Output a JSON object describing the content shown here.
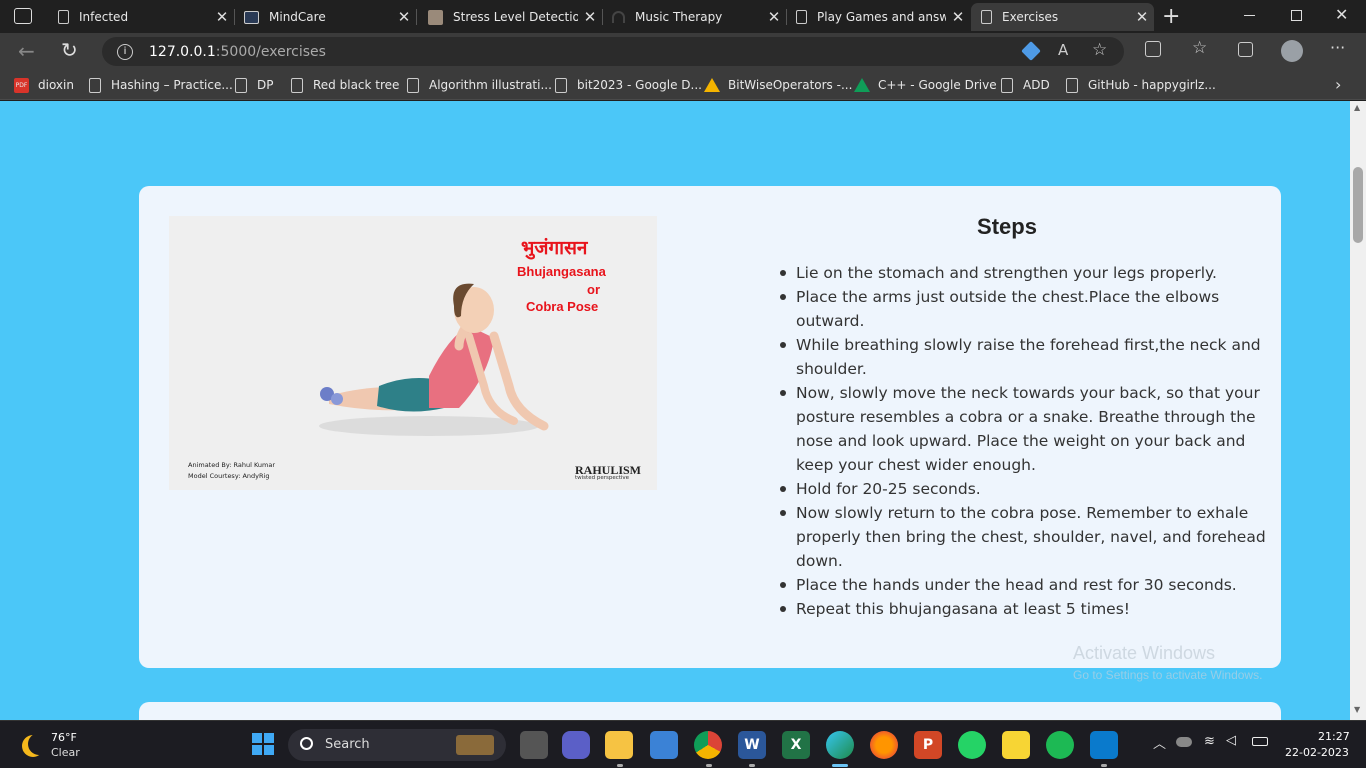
{
  "tabs": [
    {
      "label": "Infected",
      "active": false
    },
    {
      "label": "MindCare",
      "active": false
    },
    {
      "label": "Stress Level Detection",
      "active": false
    },
    {
      "label": "Music Therapy",
      "active": false
    },
    {
      "label": "Play Games and answe",
      "active": false
    },
    {
      "label": "Exercises",
      "active": true
    }
  ],
  "address": {
    "host": "127.0.0.1",
    "path": ":5000/exercises"
  },
  "bookmarks": [
    {
      "label": "dioxin",
      "icon": "pdf-icon"
    },
    {
      "label": "Hashing – Practice...",
      "icon": "page-icon"
    },
    {
      "label": "DP",
      "icon": "page-icon"
    },
    {
      "label": "Red black tree",
      "icon": "page-icon"
    },
    {
      "label": "Algorithm illustrati...",
      "icon": "page-icon"
    },
    {
      "label": "bit2023 - Google D...",
      "icon": "page-icon"
    },
    {
      "label": "BitWiseOperators -...",
      "icon": "drive-icon"
    },
    {
      "label": "C++ - Google Drive",
      "icon": "drive-icon"
    },
    {
      "label": "ADD",
      "icon": "page-icon"
    },
    {
      "label": "GitHub - happygirlz...",
      "icon": "page-icon"
    }
  ],
  "exercise": {
    "image_title_hindi": "भुजंगासन",
    "image_title_line1": "Bhujangasana",
    "image_title_line2": "or",
    "image_title_line3": "Cobra Pose",
    "credit_line1": "Animated By: Rahul Kumar",
    "credit_line2": "Model Courtesy: AndyRig",
    "logo_text": "RAHULISM",
    "logo_sub": "twisted perspective",
    "steps_title": "Steps",
    "steps": [
      "Lie on the stomach and strengthen your legs properly.",
      "Place the arms just outside the chest.Place the elbows outward.",
      "While breathing slowly raise the forehead first,the neck and shoulder.",
      "Now, slowly move the neck towards your back, so that your posture resembles a cobra or a snake. Breathe through the nose and look upward. Place the weight on your back and keep your chest wider enough.",
      "Hold for 20-25 seconds.",
      "Now slowly return to the cobra pose. Remember to exhale properly then bring the chest, shoulder, navel, and forehead down.",
      "Place the hands under the head and rest for 30 seconds.",
      "Repeat this bhujangasana at least 5 times!"
    ]
  },
  "watermark": {
    "title": "Activate Windows",
    "subtitle": "Go to Settings to activate Windows."
  },
  "taskbar": {
    "weather_temp": "76°F",
    "weather_desc": "Clear",
    "search_label": "Search",
    "time": "21:27",
    "date": "22-02-2023"
  },
  "colors": {
    "page_bg": "#4bc7f8",
    "card_bg": "#eef5fd",
    "pose_red": "#e8141c"
  }
}
